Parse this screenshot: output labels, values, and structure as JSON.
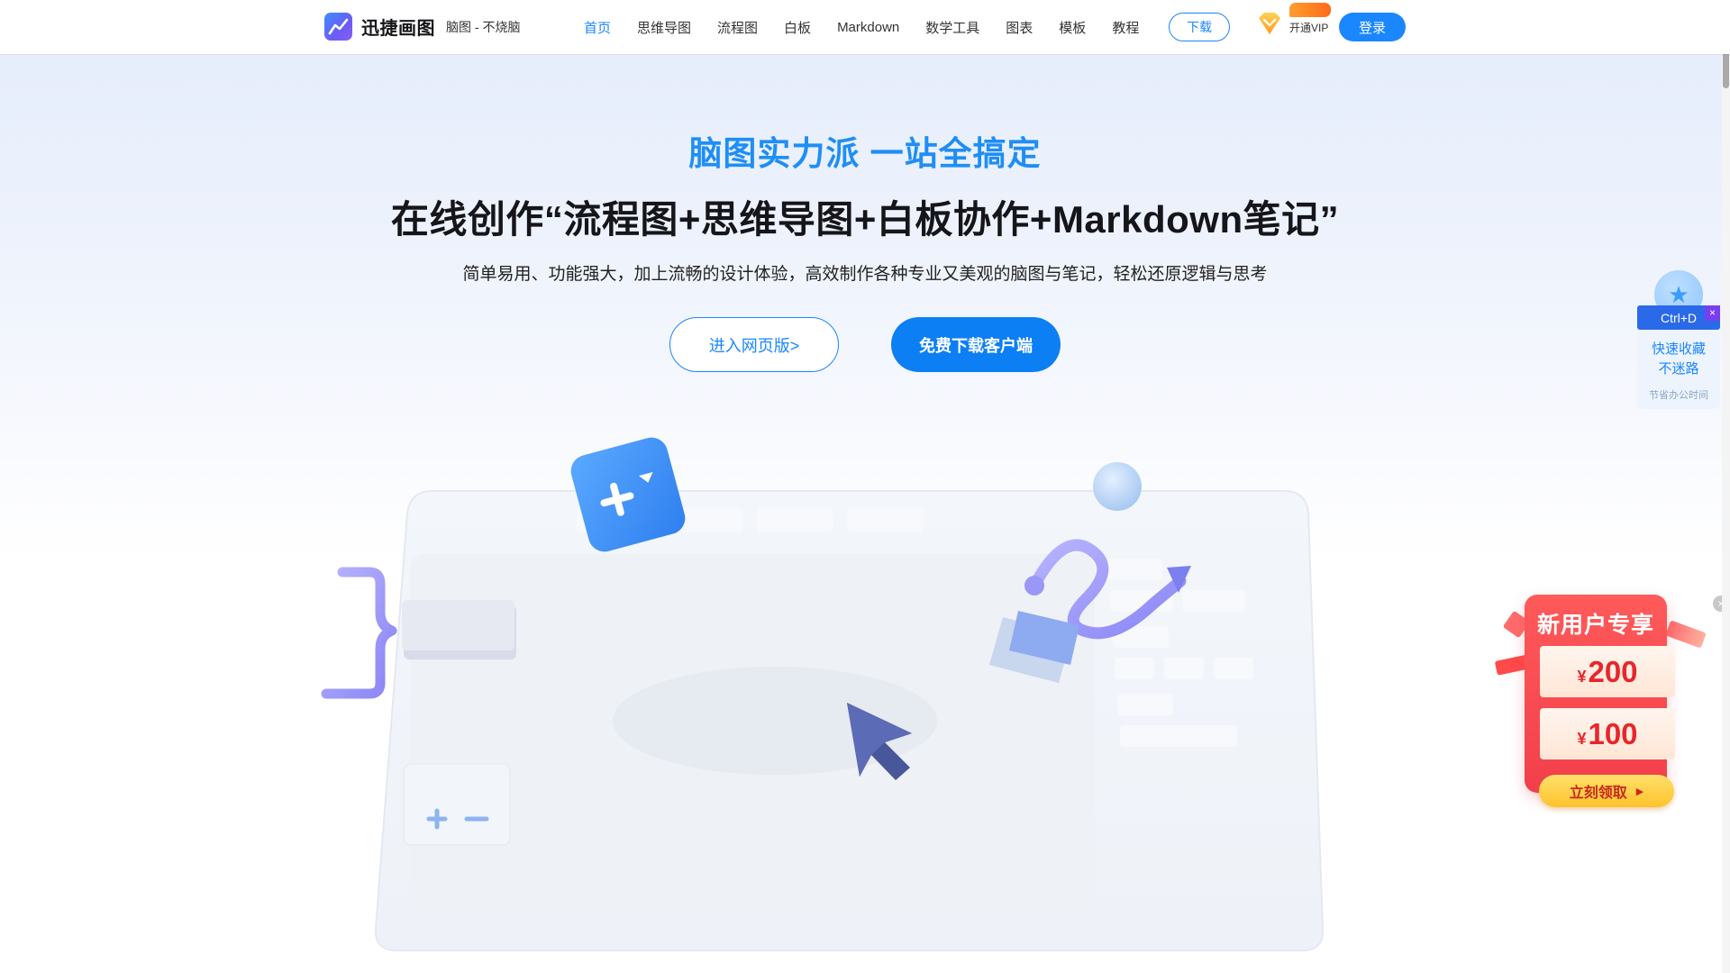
{
  "brand": {
    "name": "迅捷画图",
    "slogan": "脑图 - 不烧脑"
  },
  "nav": {
    "items": [
      {
        "label": "首页",
        "active": true
      },
      {
        "label": "思维导图",
        "active": false
      },
      {
        "label": "流程图",
        "active": false
      },
      {
        "label": "白板",
        "active": false
      },
      {
        "label": "Markdown",
        "active": false
      },
      {
        "label": "数学工具",
        "active": false
      },
      {
        "label": "图表",
        "active": false
      },
      {
        "label": "模板",
        "active": false
      },
      {
        "label": "教程",
        "active": false
      }
    ],
    "download_label": "下载",
    "vip_label": "开通VIP",
    "login_label": "登录"
  },
  "hero": {
    "tagline": "脑图实力派 一站全搞定",
    "title": "在线创作“流程图+思维导图+白板协作+Markdown笔记”",
    "description": "简单易用、功能强大，加上流畅的设计体验，高效制作各种专业又美观的脑图与笔记，轻松还原逻辑与思考",
    "web_button": "进入网页版>",
    "client_button": "免费下载客户端"
  },
  "bookmark_widget": {
    "shortcut": "Ctrl+D",
    "close": "×",
    "line1": "快速收藏",
    "line2": "不迷路",
    "line3": "节省办公时间"
  },
  "promo": {
    "title": "新用户专享",
    "coupons": [
      {
        "currency": "¥",
        "amount": "200"
      },
      {
        "currency": "¥",
        "amount": "100"
      }
    ],
    "button": "立刻领取",
    "close": "×"
  },
  "colors": {
    "accent": "#1a86ff",
    "promo_red": "#f23f4a",
    "vip_orange": "#ff7a1a"
  },
  "icons": [
    "logo-chart-icon",
    "vip-diamond-icon",
    "star-icon",
    "arrow-right-icon",
    "close-icon"
  ]
}
